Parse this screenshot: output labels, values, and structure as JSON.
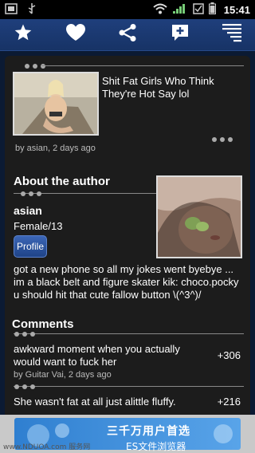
{
  "status_bar": {
    "time": "15:41"
  },
  "toolbar": {
    "icons": [
      "star-icon",
      "heart-icon",
      "share-icon",
      "add-comment-icon",
      "menu-icon"
    ]
  },
  "post": {
    "title": "Shit Fat Girls Who Think They're Hot Say lol",
    "meta": "by asian, 2 days ago"
  },
  "author": {
    "section_title": "About the author",
    "name": "asian",
    "gender_age": "Female/13",
    "profile_label": "Profile",
    "bio": "got a new phone so all my jokes went byebye ... im a black belt and figure skater kik: choco.pocky u should hit that cute fallow button \\(^3^)/"
  },
  "comments": {
    "section_title": "Comments",
    "items": [
      {
        "text": "awkward moment when you actually would want to fuck her",
        "score": "+306",
        "meta": "by Guitar Vai, 2 days ago"
      },
      {
        "text": "She wasn't fat at all just alittle fluffy.",
        "score": "+216"
      }
    ]
  },
  "ad": {
    "line1": "三千万用户首选",
    "line2": "ES文件浏览器",
    "watermark": "www.NDUOA.com 服务网"
  },
  "colors": {
    "toolbar": "#1f3f7c",
    "background": "#0b1a33",
    "card": "#1c1c1c",
    "button": "#2d57a8"
  }
}
